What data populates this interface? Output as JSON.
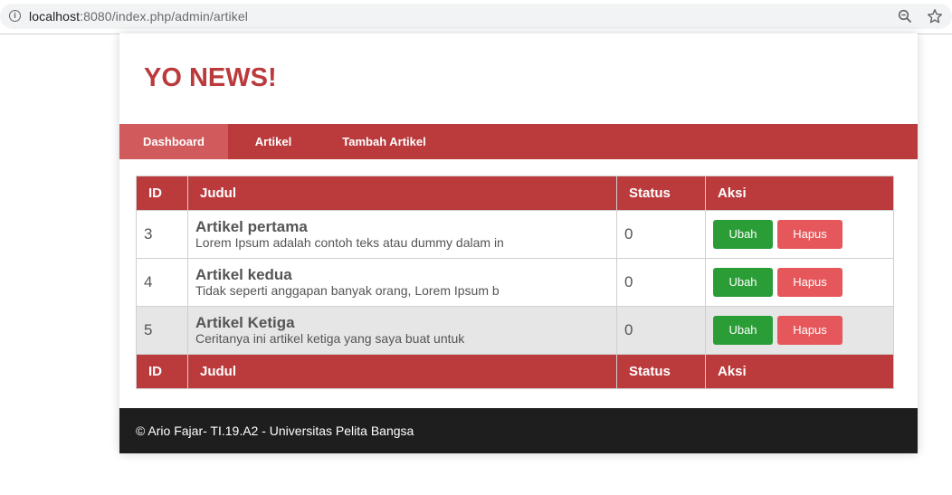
{
  "browser": {
    "url_host": "localhost",
    "url_rest": ":8080/index.php/admin/artikel"
  },
  "site": {
    "title": "YO NEWS!"
  },
  "nav": {
    "items": [
      {
        "label": "Dashboard",
        "active": true
      },
      {
        "label": "Artikel",
        "active": false
      },
      {
        "label": "Tambah Artikel",
        "active": false
      }
    ]
  },
  "table": {
    "headers": [
      "ID",
      "Judul",
      "Status",
      "Aksi"
    ],
    "rows": [
      {
        "id": "3",
        "title": "Artikel pertama",
        "excerpt": "Lorem Ipsum adalah contoh teks atau dummy dalam in",
        "status": "0",
        "edit_label": "Ubah",
        "delete_label": "Hapus"
      },
      {
        "id": "4",
        "title": "Artikel kedua",
        "excerpt": "Tidak seperti anggapan banyak orang, Lorem Ipsum b",
        "status": "0",
        "edit_label": "Ubah",
        "delete_label": "Hapus"
      },
      {
        "id": "5",
        "title": "Artikel Ketiga",
        "excerpt": "Ceritanya ini artikel ketiga yang saya buat untuk",
        "status": "0",
        "edit_label": "Ubah",
        "delete_label": "Hapus"
      }
    ],
    "footers": [
      "ID",
      "Judul",
      "Status",
      "Aksi"
    ]
  },
  "footer": {
    "text": "© Ario Fajar- TI.19.A2 - Universitas Pelita Bangsa"
  },
  "colors": {
    "brand_red": "#bb3a3c",
    "nav_active": "#d05a5c",
    "btn_edit": "#2b9d37",
    "btn_delete": "#e5575a",
    "footer_bg": "#1e1e1e"
  },
  "icons": {
    "info": "info-icon",
    "zoom": "zoom-icon",
    "bookmark": "star-icon"
  }
}
